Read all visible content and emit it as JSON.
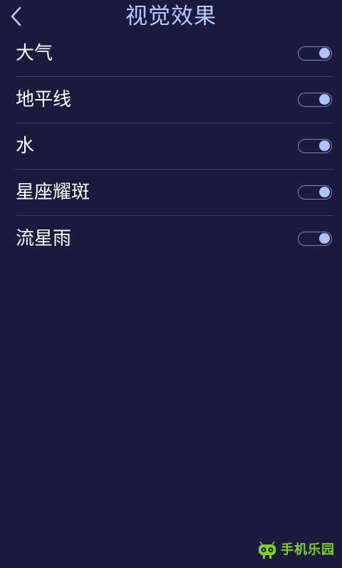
{
  "header": {
    "title": "视觉效果",
    "back_icon": "chevron-left-icon"
  },
  "settings": [
    {
      "label": "大气",
      "enabled": true
    },
    {
      "label": "地平线",
      "enabled": true
    },
    {
      "label": "水",
      "enabled": true
    },
    {
      "label": "星座耀斑",
      "enabled": true
    },
    {
      "label": "流星雨",
      "enabled": true
    }
  ],
  "watermark": {
    "text": "手机乐园",
    "icon": "phone-robot-logo-icon"
  },
  "colors": {
    "background": "#1b1b3e",
    "title": "#b7c9ff",
    "label": "#ffffff",
    "divider": "#3a3a62",
    "toggle_border": "#7d87b8",
    "toggle_knob": "#aec4ff",
    "watermark": "#7ed321"
  }
}
